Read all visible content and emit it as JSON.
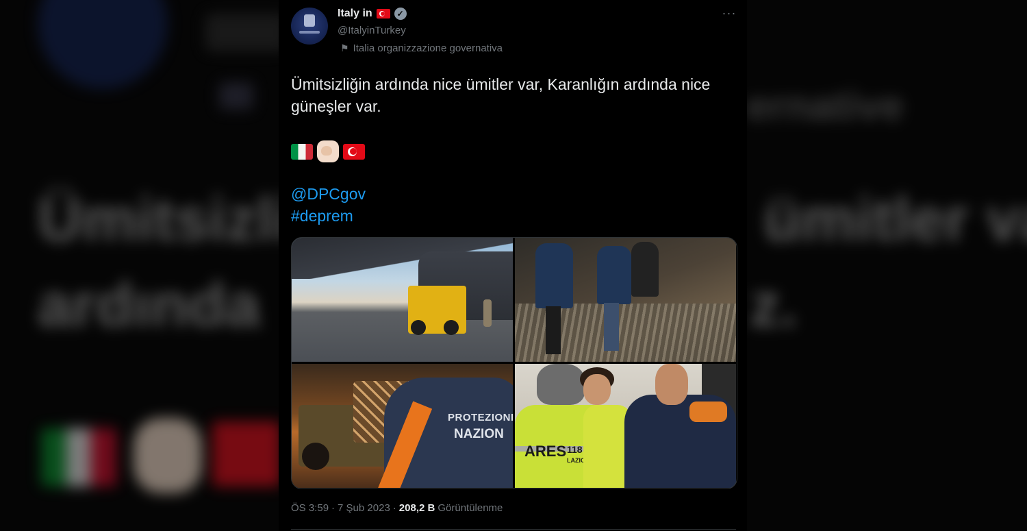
{
  "background": {
    "blurred_gov": "ernative",
    "blurred_line1_left": "Ümitsizli",
    "blurred_line1_right": "ümitler va",
    "blurred_line2_left": "ardında",
    "blurred_line2_right": "z."
  },
  "author": {
    "display_name": "Italy in",
    "handle": "@ItalyinTurkey",
    "affiliation": "Italia organizzazione governativa",
    "verified": true
  },
  "tweet": {
    "text": "Ümitsizliğin ardında nice ümitler var, Karanlığın ardında nice güneşler var.",
    "mention": "@DPCgov",
    "hashtag": "#deprem",
    "emojis": [
      "italy-flag",
      "flexed-biceps",
      "turkey-flag"
    ]
  },
  "media": {
    "photo3_text_line1": "PROTEZIONE",
    "photo3_text_line2": "NAZION",
    "photo4_text_ares": "ARES",
    "photo4_text_118": "118",
    "photo4_text_lazio": "LAZIO"
  },
  "meta": {
    "time": "ÖS 3:59",
    "separator1": "·",
    "date": "7 Şub 2023",
    "separator2": "·",
    "views_count": "208,2 B",
    "views_label": "Görüntülenme"
  },
  "icons": {
    "more": "more-horizontal-icon",
    "verified": "verified-badge-icon",
    "affiliation": "flag-outline-icon"
  },
  "colors": {
    "link": "#1d9bf0",
    "text": "#e7e9ea",
    "secondary": "#71767b",
    "background": "#000000"
  }
}
